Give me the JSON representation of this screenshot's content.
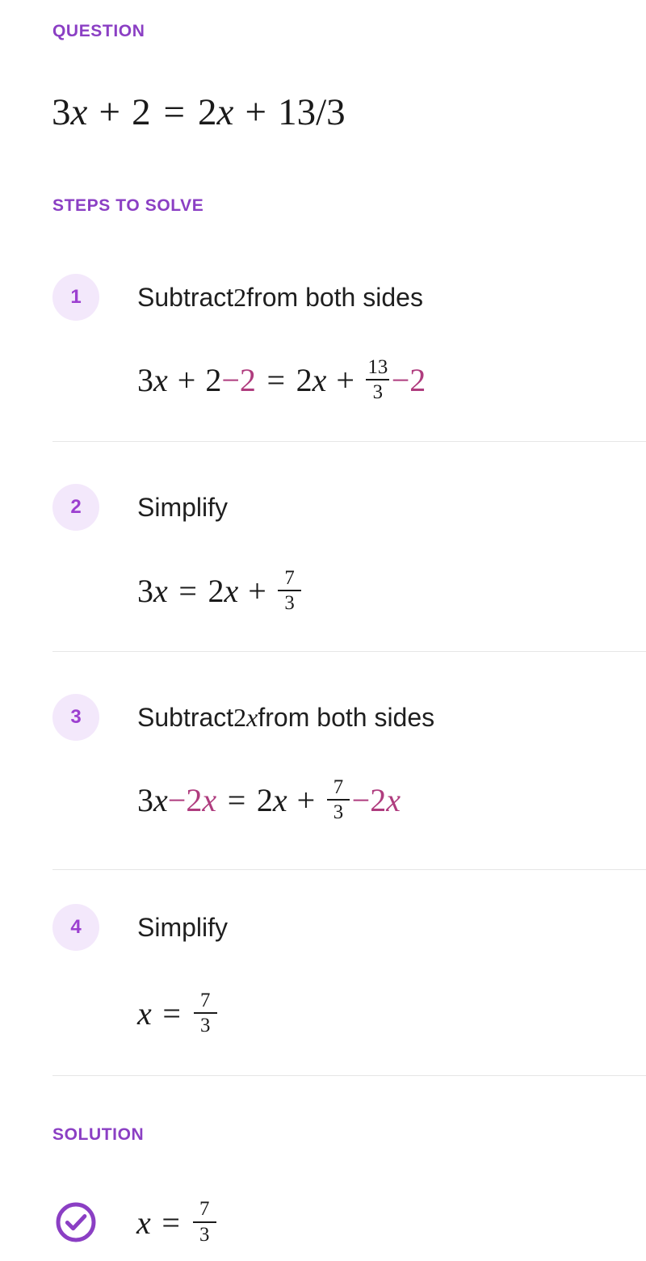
{
  "theme": {
    "accent_purple": "#8B3FC4",
    "badge_bg": "#F3E8FB",
    "badge_text": "#9C3FD0",
    "highlight_magenta": "#AF3C7E",
    "text": "#1f1f1f",
    "divider": "#e6e6e6",
    "background": "#ffffff"
  },
  "question": {
    "header": "QUESTION",
    "equation_text": "3x + 2 = 2x + 13/3",
    "tokens": [
      {
        "t": "3",
        "k": "num"
      },
      {
        "t": "x",
        "k": "var"
      },
      {
        "t": "+",
        "k": "op"
      },
      {
        "t": "2",
        "k": "num"
      },
      {
        "t": "=",
        "k": "eq"
      },
      {
        "t": "2",
        "k": "num"
      },
      {
        "t": "x",
        "k": "var"
      },
      {
        "t": "+",
        "k": "op"
      },
      {
        "t": "13/3",
        "k": "num"
      }
    ]
  },
  "steps_section": {
    "header": "STEPS TO SOLVE"
  },
  "steps": [
    {
      "number": "1",
      "title_prefix": "Subtract ",
      "title_math": "2",
      "title_math_style": "num",
      "title_suffix": " from both sides",
      "title_full": "Subtract 2 from both sides",
      "equation_text": "3x + 2 − 2 = 2x + 13/3 − 2"
    },
    {
      "number": "2",
      "title_prefix": "Simplify",
      "title_math": "",
      "title_math_style": "num",
      "title_suffix": "",
      "title_full": "Simplify",
      "equation_text": "3x = 2x + 7/3"
    },
    {
      "number": "3",
      "title_prefix": "Subtract ",
      "title_math": "2x",
      "title_math_style": "mixed",
      "title_suffix": " from both sides",
      "title_full": "Subtract 2x from both sides",
      "equation_text": "3x − 2x = 2x + 7/3 − 2x"
    },
    {
      "number": "4",
      "title_prefix": "Simplify",
      "title_math": "",
      "title_math_style": "num",
      "title_suffix": "",
      "title_full": "Simplify",
      "equation_text": "x = 7/3"
    }
  ],
  "solution": {
    "header": "SOLUTION",
    "icon": "check-circle-icon",
    "equation_text": "x = 7/3",
    "value_numerator": "7",
    "value_denominator": "3",
    "variable": "x"
  },
  "fractions": {
    "thirteen_thirds": {
      "num": "13",
      "den": "3"
    },
    "seven_thirds": {
      "num": "7",
      "den": "3"
    }
  },
  "labels": {
    "q_3": "3",
    "q_x": "x",
    "q_plus": "+",
    "q_2": "2",
    "q_eq": "=",
    "q_13over3": "13/3",
    "minus": "−",
    "two": "2",
    "twox_2": "2",
    "twox_x": "x",
    "three": "3",
    "seven": "7"
  }
}
